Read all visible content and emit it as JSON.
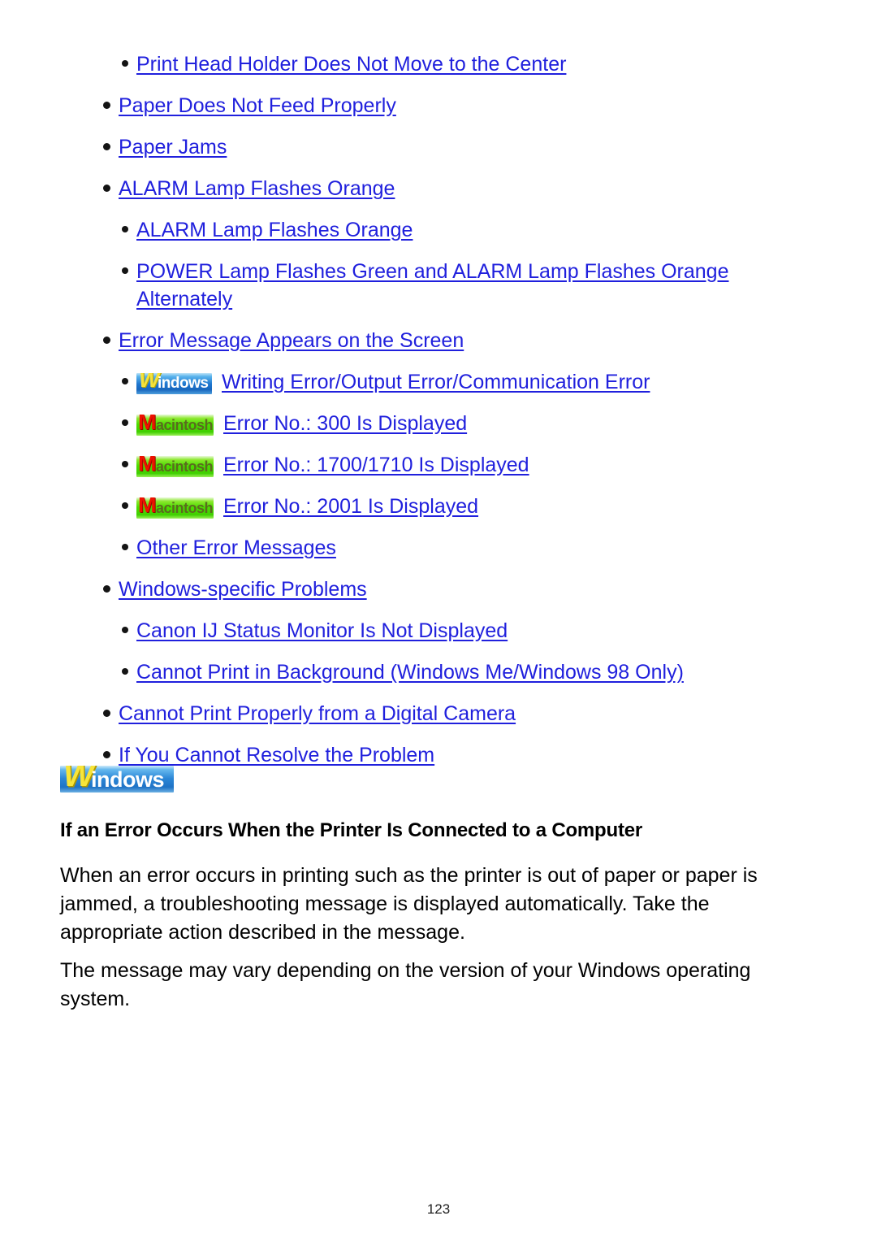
{
  "page": {
    "number": "123",
    "background": "#ffffff",
    "link_color": "#2020dd",
    "text_color": "#000000"
  },
  "badges": {
    "windows": {
      "lead": "W",
      "rest": "indows",
      "bg_start": "#bfe3f7",
      "bg_end": "#4f9fdd",
      "lead_color": "#f5e23c",
      "rest_color": "#ffffff"
    },
    "macintosh": {
      "lead": "M",
      "rest": "acintosh",
      "bg_start": "#8ce82e",
      "bg_end": "#9cee58",
      "lead_color": "#ee1100",
      "rest_color": "#5a6b1f"
    }
  },
  "toc": {
    "items": [
      {
        "level": 2,
        "badge": "none",
        "label": "Print Head Holder Does Not Move to the Center"
      },
      {
        "level": 1,
        "badge": "none",
        "label": "Paper Does Not Feed Properly"
      },
      {
        "level": 1,
        "badge": "none",
        "label": "Paper Jams"
      },
      {
        "level": 1,
        "badge": "none",
        "label": "ALARM Lamp Flashes Orange"
      },
      {
        "level": 2,
        "badge": "none",
        "label": "ALARM Lamp Flashes Orange"
      },
      {
        "level": 2,
        "badge": "none",
        "label": "POWER Lamp Flashes Green and ALARM Lamp Flashes Orange Alternately"
      },
      {
        "level": 1,
        "badge": "none",
        "label": "Error Message Appears on the Screen"
      },
      {
        "level": 2,
        "badge": "windows",
        "label": "Writing Error/Output Error/Communication Error"
      },
      {
        "level": 2,
        "badge": "macintosh",
        "label": "Error No.: 300 Is Displayed"
      },
      {
        "level": 2,
        "badge": "macintosh",
        "label": "Error No.: 1700/1710 Is Displayed"
      },
      {
        "level": 2,
        "badge": "macintosh",
        "label": "Error No.: 2001 Is Displayed"
      },
      {
        "level": 2,
        "badge": "none",
        "label": "Other Error Messages"
      },
      {
        "level": 1,
        "badge": "none",
        "label": "Windows-specific Problems"
      },
      {
        "level": 2,
        "badge": "none",
        "label": "Canon IJ Status Monitor Is Not Displayed"
      },
      {
        "level": 2,
        "badge": "none",
        "label": "Cannot Print in Background (Windows Me/Windows 98 Only)"
      },
      {
        "level": 1,
        "badge": "none",
        "label": "Cannot Print Properly from a Digital Camera"
      },
      {
        "level": 1,
        "badge": "none",
        "label": "If You Cannot Resolve the Problem"
      }
    ]
  },
  "section": {
    "banner_badge": "windows",
    "heading": "If an Error Occurs When the Printer Is Connected to a Computer",
    "paragraphs": [
      "When an error occurs in printing such as the printer is out of paper or paper is jammed, a troubleshooting message is displayed automatically. Take the appropriate action described in the message.",
      "The message may vary depending on the version of your Windows operating system."
    ]
  }
}
